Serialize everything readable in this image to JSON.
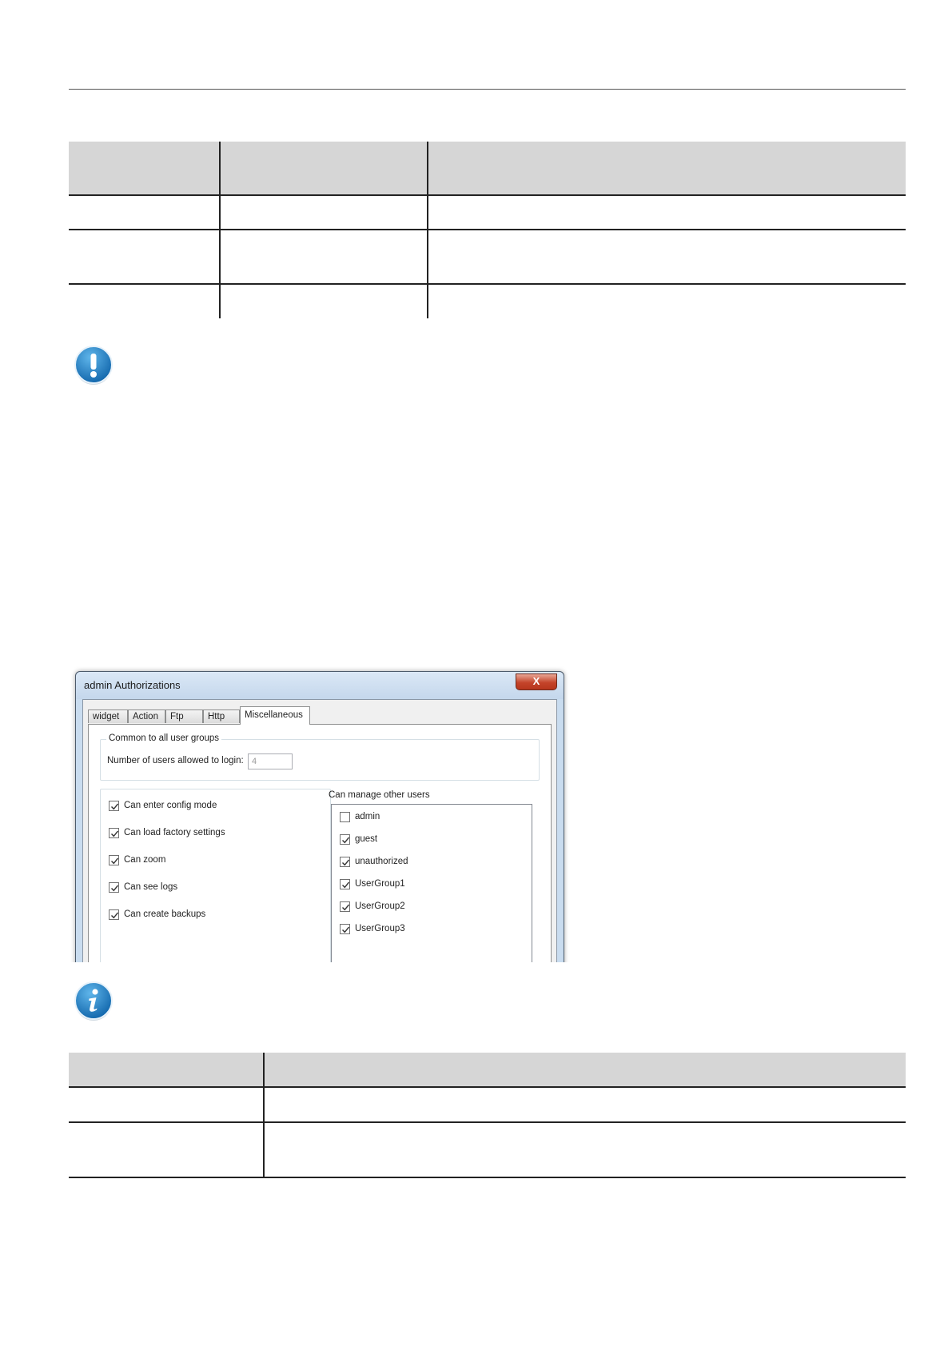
{
  "dialog": {
    "title": "admin Authorizations",
    "close_label": "X",
    "tabs": [
      {
        "label": "widget",
        "active": false
      },
      {
        "label": "Action",
        "active": false
      },
      {
        "label": "Ftp",
        "active": false
      },
      {
        "label": "Http",
        "active": false
      },
      {
        "label": "Miscellaneous",
        "active": true
      }
    ],
    "common_group": {
      "title": "Common to all user groups",
      "login_label": "Number of users allowed to login:",
      "login_value": "4"
    },
    "permissions": [
      {
        "label": "Can enter config mode",
        "checked": true
      },
      {
        "label": "Can load factory settings",
        "checked": true
      },
      {
        "label": "Can zoom",
        "checked": true
      },
      {
        "label": "Can see logs",
        "checked": true
      },
      {
        "label": "Can create backups",
        "checked": true
      }
    ],
    "manage": {
      "title": "Can manage other users",
      "users": [
        {
          "label": "admin",
          "checked": false
        },
        {
          "label": "guest",
          "checked": true
        },
        {
          "label": "unauthorized",
          "checked": true
        },
        {
          "label": "UserGroup1",
          "checked": true
        },
        {
          "label": "UserGroup2",
          "checked": true
        },
        {
          "label": "UserGroup3",
          "checked": true
        }
      ]
    }
  },
  "icons": {
    "warning": "exclamation-icon",
    "info": "info-icon"
  },
  "colors": {
    "callout_blue": "#1f82c8",
    "table_header": "#d6d6d6"
  }
}
